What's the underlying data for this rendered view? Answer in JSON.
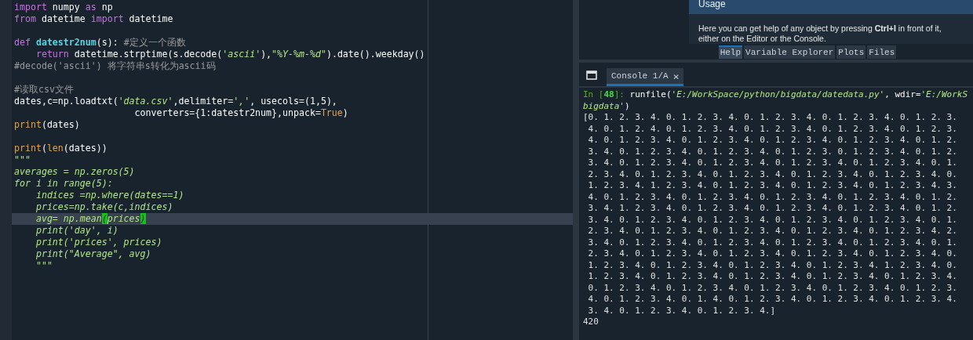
{
  "editor": {
    "lines": [
      {
        "segments": [
          {
            "kind": "keyword",
            "text": "import"
          },
          {
            "kind": "plain",
            "text": " numpy "
          },
          {
            "kind": "keyword",
            "text": "as"
          },
          {
            "kind": "plain",
            "text": " np"
          }
        ]
      },
      {
        "segments": [
          {
            "kind": "keyword",
            "text": "from"
          },
          {
            "kind": "plain",
            "text": " datetime "
          },
          {
            "kind": "keyword",
            "text": "import"
          },
          {
            "kind": "plain",
            "text": " datetime"
          }
        ]
      },
      {
        "current": false
      },
      {
        "segments": [
          {
            "kind": "keyword",
            "text": "def"
          },
          {
            "kind": "defname",
            "text": " datestr2num"
          },
          {
            "kind": "plain",
            "text": "(s): "
          },
          {
            "kind": "comment",
            "text": "#定义一个函数"
          }
        ]
      },
      {
        "segments": [
          {
            "kind": "keyword",
            "text": "    return"
          },
          {
            "kind": "plain",
            "text": " datetime.strptime(s.decode("
          },
          {
            "kind": "string",
            "text": "'ascii'"
          },
          {
            "kind": "plain",
            "text": "),"
          },
          {
            "kind": "string",
            "text": "\"%Y-%m-%d\""
          },
          {
            "kind": "plain",
            "text": ").date().weekday()"
          }
        ]
      },
      {
        "segments": [
          {
            "kind": "comment",
            "text": "#decode('ascii') 将字符串s转化为ascii码"
          }
        ]
      },
      {
        "current": false
      },
      {
        "segments": [
          {
            "kind": "comment",
            "text": "#读取csv文件"
          }
        ]
      },
      {
        "segments": [
          {
            "kind": "plain",
            "text": "dates,c=np.loadtxt("
          },
          {
            "kind": "string",
            "text": "'data.csv'"
          },
          {
            "kind": "plain",
            "text": ",delimiter="
          },
          {
            "kind": "string",
            "text": "','"
          },
          {
            "kind": "plain",
            "text": ", usecols=(1,5),"
          }
        ]
      },
      {
        "segments": [
          {
            "kind": "plain",
            "text": "                      converters={1:datestr2num},unpack="
          },
          {
            "kind": "builtin",
            "text": "True"
          },
          {
            "kind": "plain",
            "text": ")"
          }
        ]
      },
      {
        "segments": [
          {
            "kind": "builtin",
            "text": "print"
          },
          {
            "kind": "plain",
            "text": "(dates)"
          }
        ]
      },
      {
        "current": false
      },
      {
        "segments": [
          {
            "kind": "builtin",
            "text": "print"
          },
          {
            "kind": "plain",
            "text": "("
          },
          {
            "kind": "builtin",
            "text": "len"
          },
          {
            "kind": "plain",
            "text": "(dates))"
          }
        ]
      },
      {
        "segments": [
          {
            "kind": "docstring",
            "text": "\"\"\""
          }
        ]
      },
      {
        "segments": [
          {
            "kind": "docstring",
            "text": "averages = np.zeros(5)"
          }
        ]
      },
      {
        "segments": [
          {
            "kind": "docstring",
            "text": "for i in range(5):"
          }
        ]
      },
      {
        "segments": [
          {
            "kind": "docstring",
            "text": "    indices =np.where(dates==1)"
          }
        ]
      },
      {
        "segments": [
          {
            "kind": "docstring",
            "text": "    prices=np.take(c,indices)"
          }
        ]
      },
      {
        "current": true,
        "segments": [
          {
            "kind": "docstring",
            "text": "    avg= np.mean"
          },
          {
            "kind": "match",
            "text": "("
          },
          {
            "kind": "docstring",
            "text": "prices"
          },
          {
            "kind": "match",
            "text": ")"
          }
        ]
      },
      {
        "segments": [
          {
            "kind": "docstring",
            "text": "    print('day', i)"
          }
        ]
      },
      {
        "segments": [
          {
            "kind": "docstring",
            "text": "    print('prices', prices)"
          }
        ]
      },
      {
        "segments": [
          {
            "kind": "docstring",
            "text": "    print(\"Average\", avg)"
          }
        ]
      },
      {
        "segments": [
          {
            "kind": "docstring",
            "text": "    \"\"\""
          }
        ]
      }
    ]
  },
  "help": {
    "heading": "Usage",
    "text": "Here you can get help of any object by pressing **Ctrl+I** in front of it, either on the Editor or the Console."
  },
  "pane_tabs": [
    {
      "label": "Help",
      "selected": true
    },
    {
      "label": "Variable Explorer",
      "selected": false
    },
    {
      "label": "Plots",
      "selected": false
    },
    {
      "label": "Files",
      "selected": false
    }
  ],
  "console": {
    "tab": {
      "label": "Console 1/A",
      "close": "×",
      "selected": true
    },
    "prompt": {
      "in": "In [",
      "number": "48",
      "close": "]:",
      "code": " runfile(",
      "path": "'E:/WorkSpace/python/bigdata/datedata.py'",
      "middle": ", wdir=",
      "wdir": "'E:/WorkS",
      "wdir_rest": "bigdata'",
      "end": ")"
    },
    "output": [
      "[0. 1. 2. 3. 4. 0. 1. 2. 3. 4. 0. 1. 2. 3. 4. 0. 1. 2. 3. 4. 0. 1. 2. 3.",
      " 4. 0. 1. 2. 4. 0. 1. 2. 3. 4. 0. 1. 2. 3. 4. 0. 1. 2. 3. 4. 0. 1. 2. 3.",
      " 4. 0. 1. 2. 3. 4. 0. 1. 2. 3. 4. 0. 1. 2. 3. 4. 0. 1. 2. 3. 4. 0. 1. 2.",
      " 3. 4. 0. 1. 2. 3. 4. 0. 1. 2. 3. 4. 0. 1. 2. 3. 0. 1. 2. 3. 4. 0. 1. 2.",
      " 3. 4. 0. 1. 2. 3. 4. 0. 1. 2. 3. 4. 0. 1. 2. 3. 4. 0. 1. 2. 3. 4. 0. 1.",
      " 2. 3. 4. 0. 1. 2. 3. 4. 0. 1. 2. 3. 4. 0. 1. 2. 3. 4. 0. 1. 2. 3. 4. 0.",
      " 1. 2. 3. 4. 1. 2. 3. 4. 0. 1. 2. 3. 4. 0. 1. 2. 3. 4. 0. 1. 2. 3. 4. 3.",
      " 4. 0. 1. 2. 3. 4. 0. 1. 2. 3. 4. 0. 1. 2. 3. 4. 0. 1. 2. 3. 4. 0. 1. 2.",
      " 3. 4. 1. 2. 3. 4. 0. 1. 2. 3. 4. 0. 1. 2. 3. 4. 0. 1. 2. 3. 4. 0. 1. 2.",
      " 3. 4. 0. 1. 2. 3. 4. 0. 1. 2. 3. 4. 0. 1. 2. 3. 4. 0. 1. 2. 3. 4. 0. 1.",
      " 2. 3. 4. 0. 1. 2. 3. 4. 0. 1. 2. 3. 4. 0. 1. 2. 3. 4. 0. 1. 2. 3. 4. 2.",
      " 3. 4. 0. 1. 2. 3. 4. 0. 1. 2. 3. 4. 0. 1. 2. 3. 4. 0. 1. 2. 3. 4. 0. 1.",
      " 2. 3. 4. 0. 1. 2. 3. 4. 0. 1. 2. 3. 4. 0. 1. 2. 3. 4. 0. 1. 2. 3. 4. 0.",
      " 1. 2. 3. 4. 0. 1. 2. 3. 4. 0. 1. 2. 3. 4. 0. 1. 2. 3. 4. 1. 2. 3. 4. 0.",
      " 1. 2. 3. 4. 0. 1. 2. 3. 4. 0. 1. 2. 3. 4. 0. 1. 2. 3. 4. 0. 1. 2. 3. 4.",
      " 0. 1. 2. 3. 4. 0. 1. 2. 3. 4. 0. 1. 2. 3. 4. 0. 1. 2. 3. 4. 0. 1. 2. 3.",
      " 4. 0. 1. 2. 3. 4. 0. 1. 4. 0. 1. 2. 3. 4. 0. 1. 2. 3. 4. 0. 1. 2. 3. 4.",
      " 3. 4. 0. 1. 2. 3. 4. 0. 1. 2. 3. 4.]",
      "420"
    ]
  }
}
